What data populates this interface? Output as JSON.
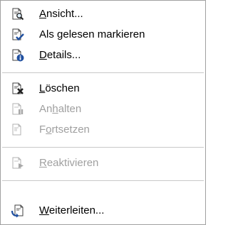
{
  "menu": {
    "items": [
      {
        "pre": "",
        "ul": "A",
        "post": "nsicht...",
        "icon": "view-document-icon",
        "enabled": true
      },
      {
        "pre": "Als ",
        "ul": "g",
        "post": "elesen markieren",
        "icon": "mark-read-icon",
        "enabled": true
      },
      {
        "pre": "",
        "ul": "D",
        "post": "etails...",
        "icon": "details-info-icon",
        "enabled": true
      },
      {
        "pre": "",
        "ul": "L",
        "post": "öschen",
        "icon": "delete-icon",
        "enabled": true
      },
      {
        "pre": "An",
        "ul": "h",
        "post": "alten",
        "icon": "pause-icon",
        "enabled": false
      },
      {
        "pre": "F",
        "ul": "o",
        "post": "rtsetzen",
        "icon": "resume-icon",
        "enabled": false
      },
      {
        "pre": "",
        "ul": "R",
        "post": "eaktivieren",
        "icon": "reactivate-icon",
        "enabled": false
      },
      {
        "pre": "",
        "ul": "W",
        "post": "eiterleiten...",
        "icon": "forward-icon",
        "enabled": true
      }
    ]
  },
  "colors": {
    "border": "#a0a0a0",
    "separator": "#c8c8c8",
    "disabled_text": "#a0a0a0",
    "accent_blue": "#1f4f9f",
    "delete_red": "#c00000"
  }
}
